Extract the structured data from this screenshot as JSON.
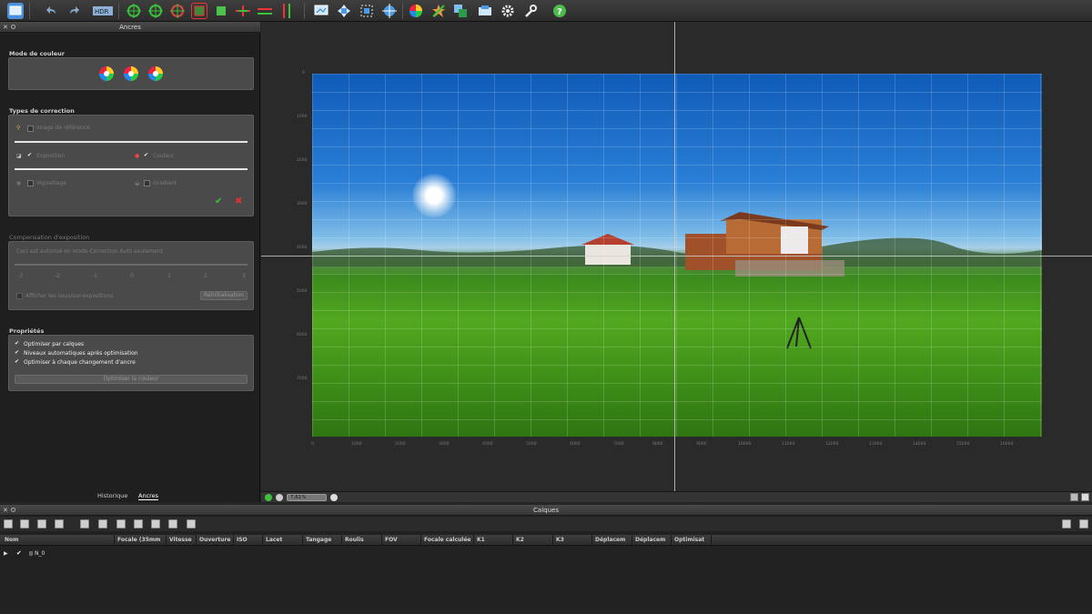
{
  "toolbar": {
    "icons": [
      "project-icon",
      "undo-icon",
      "redo-icon",
      "hdr-icon",
      "anchor-icon",
      "anchor-add-icon",
      "anchor-move-icon",
      "crop-icon",
      "mask-icon",
      "horizon-icon",
      "level-icon",
      "vertical-icon",
      "preview-icon",
      "move-icon",
      "fit-icon",
      "center-icon",
      "color-wheel-icon",
      "star-icon",
      "layers-icon",
      "render-icon",
      "settings-icon",
      "tools-icon",
      "help-icon"
    ]
  },
  "left_panel": {
    "title": "Ancres",
    "mode_section": "Mode de couleur",
    "correction_section": "Types de correction",
    "correction": {
      "reference": "Image de référence",
      "exposure": "Exposition",
      "color": "Couleur",
      "vignetting": "Vignettage",
      "gradient": "Gradient"
    },
    "exposure_section": "Compensation d'exposition",
    "exposure": {
      "note": "Ceci est autorisé en mode Correction Auto seulement",
      "ticks": [
        "-3",
        "-2",
        "-1",
        "0",
        "1",
        "2",
        "3"
      ],
      "show_label": "Afficher les sous/sur-expositions",
      "reset": "Réinitialisation"
    },
    "props_section": "Propriétés",
    "props": {
      "opt1": "Optimiser par calques",
      "opt2": "Niveaux automatiques après optimisation",
      "opt3": "Optimiser à chaque changement d'ancre",
      "optimize_button": "Optimiser la couleur"
    },
    "tabs": [
      "Historique",
      "Ancres"
    ]
  },
  "viewer": {
    "y_ticks": [
      "0",
      "1000",
      "2000",
      "3000",
      "4000",
      "5000",
      "6000",
      "7000"
    ],
    "x_ticks": [
      "0",
      "1000",
      "2000",
      "3000",
      "4000",
      "5000",
      "6000",
      "7000",
      "8000",
      "9000",
      "10000",
      "11000",
      "12000",
      "13000",
      "14000",
      "15000",
      "16000"
    ],
    "zoom": "7,61%"
  },
  "layers": {
    "title": "Calques",
    "columns": [
      "Nom",
      "Focale (35mm",
      "Vitesse",
      "Ouverture",
      "ISO",
      "Lacet",
      "Tangage",
      "Roulis",
      "FOV",
      "Focale calculée",
      "K1",
      "K2",
      "K3",
      "Déplacem",
      "Déplacem",
      "Optimisat"
    ],
    "row_name": "N_0"
  }
}
